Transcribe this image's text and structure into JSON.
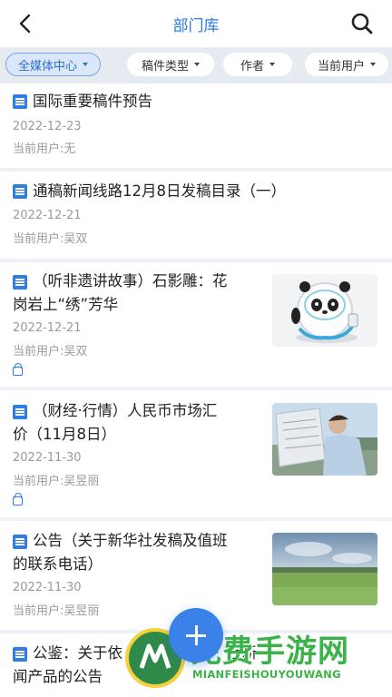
{
  "header": {
    "title": "部门库",
    "back_icon": "chevron-left-icon",
    "search_icon": "search-icon"
  },
  "filters": [
    {
      "label": "全媒体中心",
      "active": true
    },
    {
      "label": "稿件类型",
      "active": false
    },
    {
      "label": "作者",
      "active": false
    },
    {
      "label": "当前用户",
      "active": false
    }
  ],
  "articles": [
    {
      "title": "国际重要稿件预告",
      "date": "2022-12-23",
      "user": "当前用户:无"
    },
    {
      "title": "通稿新闻线路12月8日发稿目录（一）",
      "date": "2022-12-21",
      "user": "当前用户:吴双"
    },
    {
      "title_line1": "（听非遗讲故事）石影雕：花",
      "title_line2": "岗岩上“绣”芳华",
      "date": "2022-12-21",
      "user": "当前用户:吴双",
      "locked": true,
      "thumbnail": "panda-mascot-image"
    },
    {
      "title_line1": "（财经·行情）人民币市场汇",
      "title_line2": "价（11月8日）",
      "date": "2022-11-30",
      "user": "当前用户:吴昱丽",
      "locked": true,
      "thumbnail": "man-reading-newspaper-image"
    },
    {
      "title_line1": "公告（关于新华社发稿及值班",
      "title_line2": "的联系电话）",
      "date": "2022-11-30",
      "user": "当前用户:吴昱丽",
      "thumbnail": "grass-field-image"
    },
    {
      "title_line1": "公鉴：关于依",
      "title_line1b": "社新",
      "title_line2": "闻产品的公告"
    }
  ],
  "fab": {
    "icon": "plus-icon"
  },
  "watermark": {
    "text": "免费手游网",
    "subtext": "MIANFEISHOUYOUWANG"
  },
  "colors": {
    "accent": "#2a7ae2",
    "background": "#eef1f5",
    "filter_bar": "#e6ebf2"
  }
}
